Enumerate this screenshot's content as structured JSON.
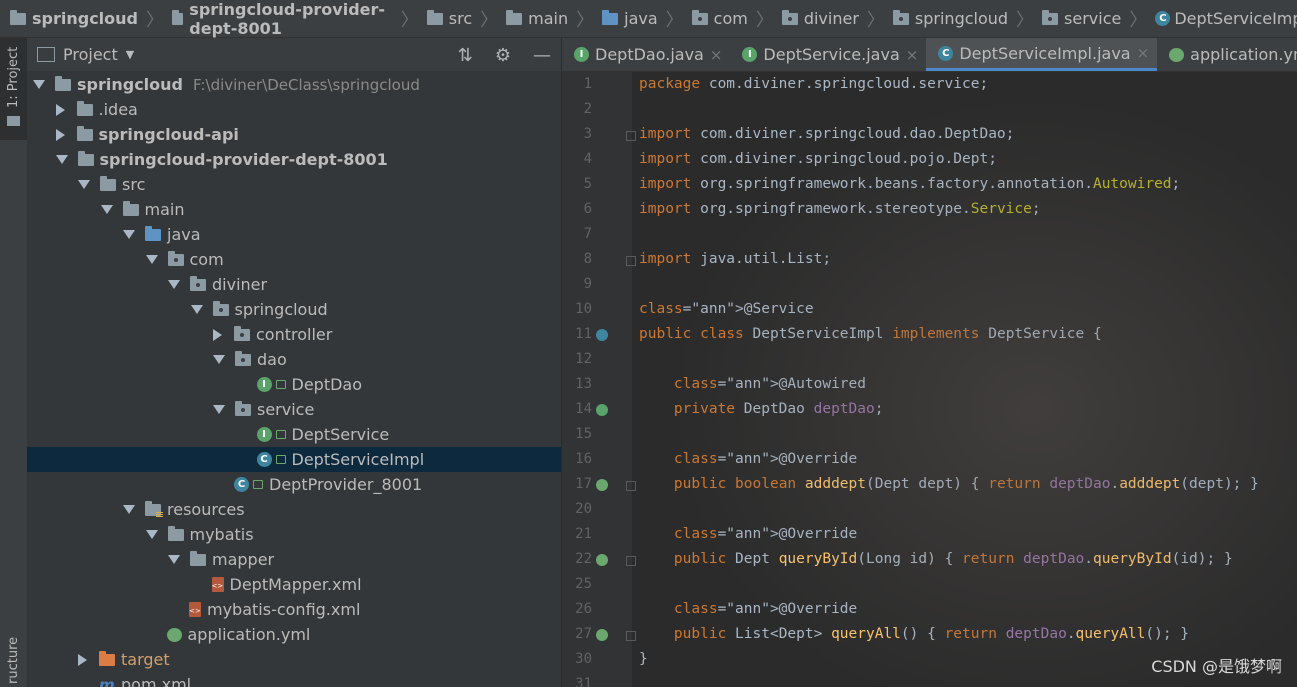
{
  "breadcrumb": [
    {
      "label": "springcloud",
      "bold": true,
      "icon": "module-folder-icon"
    },
    {
      "label": "springcloud-provider-dept-8001",
      "bold": true,
      "icon": "module-folder-icon"
    },
    {
      "label": "src",
      "icon": "folder-icon"
    },
    {
      "label": "main",
      "icon": "folder-icon"
    },
    {
      "label": "java",
      "icon": "source-folder-icon"
    },
    {
      "label": "com",
      "icon": "package-icon"
    },
    {
      "label": "diviner",
      "icon": "package-icon"
    },
    {
      "label": "springcloud",
      "icon": "package-icon"
    },
    {
      "label": "service",
      "icon": "package-icon"
    },
    {
      "label": "DeptServiceImpl",
      "icon": "class-icon"
    }
  ],
  "left_strip": {
    "project_label": "1: Project",
    "structure_label": "ructure"
  },
  "project_panel": {
    "title": "Project",
    "tree": [
      {
        "label": "springcloud",
        "path": "F:\\diviner\\DeClass\\springcloud",
        "bold": true,
        "depth": 0,
        "arrow": "down",
        "icon": "module"
      },
      {
        "label": ".idea",
        "depth": 1,
        "arrow": "right",
        "icon": "folder"
      },
      {
        "label": "springcloud-api",
        "bold": true,
        "depth": 1,
        "arrow": "right",
        "icon": "module"
      },
      {
        "label": "springcloud-provider-dept-8001",
        "bold": true,
        "depth": 1,
        "arrow": "down",
        "icon": "module"
      },
      {
        "label": "src",
        "depth": 2,
        "arrow": "down",
        "icon": "folder"
      },
      {
        "label": "main",
        "depth": 3,
        "arrow": "down",
        "icon": "folder"
      },
      {
        "label": "java",
        "depth": 4,
        "arrow": "down",
        "icon": "src"
      },
      {
        "label": "com",
        "depth": 5,
        "arrow": "down",
        "icon": "pkg"
      },
      {
        "label": "diviner",
        "depth": 6,
        "arrow": "down",
        "icon": "pkg"
      },
      {
        "label": "springcloud",
        "depth": 7,
        "arrow": "down",
        "icon": "pkg"
      },
      {
        "label": "controller",
        "depth": 8,
        "arrow": "right",
        "icon": "pkg"
      },
      {
        "label": "dao",
        "depth": 8,
        "arrow": "down",
        "icon": "pkg"
      },
      {
        "label": "DeptDao",
        "depth": 9,
        "arrow": "none",
        "icon": "interface"
      },
      {
        "label": "service",
        "depth": 8,
        "arrow": "down",
        "icon": "pkg"
      },
      {
        "label": "DeptService",
        "depth": 9,
        "arrow": "none",
        "icon": "interface"
      },
      {
        "label": "DeptServiceImpl",
        "depth": 9,
        "arrow": "none",
        "icon": "class",
        "selected": true
      },
      {
        "label": "DeptProvider_8001",
        "depth": 8,
        "arrow": "none",
        "icon": "springboot-class"
      },
      {
        "label": "resources",
        "depth": 4,
        "arrow": "down",
        "icon": "res"
      },
      {
        "label": "mybatis",
        "depth": 5,
        "arrow": "down",
        "icon": "folder"
      },
      {
        "label": "mapper",
        "depth": 6,
        "arrow": "down",
        "icon": "folder"
      },
      {
        "label": "DeptMapper.xml",
        "depth": 7,
        "arrow": "none",
        "icon": "xml"
      },
      {
        "label": "mybatis-config.xml",
        "depth": 6,
        "arrow": "none",
        "icon": "xml"
      },
      {
        "label": "application.yml",
        "depth": 5,
        "arrow": "none",
        "icon": "yml"
      },
      {
        "label": "target",
        "depth": 2,
        "arrow": "right",
        "icon": "orange",
        "orange": true
      },
      {
        "label": "pom.xml",
        "depth": 2,
        "arrow": "none",
        "icon": "maven"
      }
    ]
  },
  "tabs": [
    {
      "label": "DeptDao.java",
      "icon": "interface"
    },
    {
      "label": "DeptService.java",
      "icon": "interface"
    },
    {
      "label": "DeptServiceImpl.java",
      "icon": "class",
      "active": true
    },
    {
      "label": "application.yml",
      "icon": "yml"
    }
  ],
  "line_numbers": [
    "1",
    "2",
    "3",
    "4",
    "5",
    "6",
    "7",
    "8",
    "9",
    "10",
    "11",
    "12",
    "13",
    "14",
    "15",
    "16",
    "17",
    "20",
    "21",
    "22",
    "25",
    "26",
    "27",
    "30",
    "31"
  ],
  "code_lines": [
    "package com.diviner.springcloud.service;",
    "",
    "import com.diviner.springcloud.dao.DeptDao;",
    "import com.diviner.springcloud.pojo.Dept;",
    "import org.springframework.beans.factory.annotation.Autowired;",
    "import org.springframework.stereotype.Service;",
    "",
    "import java.util.List;",
    "",
    "@Service",
    "public class DeptServiceImpl implements DeptService {",
    "",
    "    @Autowired",
    "    private DeptDao deptDao;",
    "",
    "    @Override",
    "    public boolean adddept(Dept dept) { return deptDao.adddept(dept); }",
    "",
    "    @Override",
    "    public Dept queryById(Long id) { return deptDao.queryById(id); }",
    "",
    "    @Override",
    "    public List<Dept> queryAll() { return deptDao.queryAll(); }",
    "}",
    ""
  ],
  "watermark": "CSDN @是饿梦啊",
  "colors": {
    "keyword": "#cc7832",
    "annotation": "#bbb529",
    "field": "#9876aa",
    "method": "#ffc66d",
    "selection": "#0d293e",
    "tab_underline": "#4a88c7"
  }
}
